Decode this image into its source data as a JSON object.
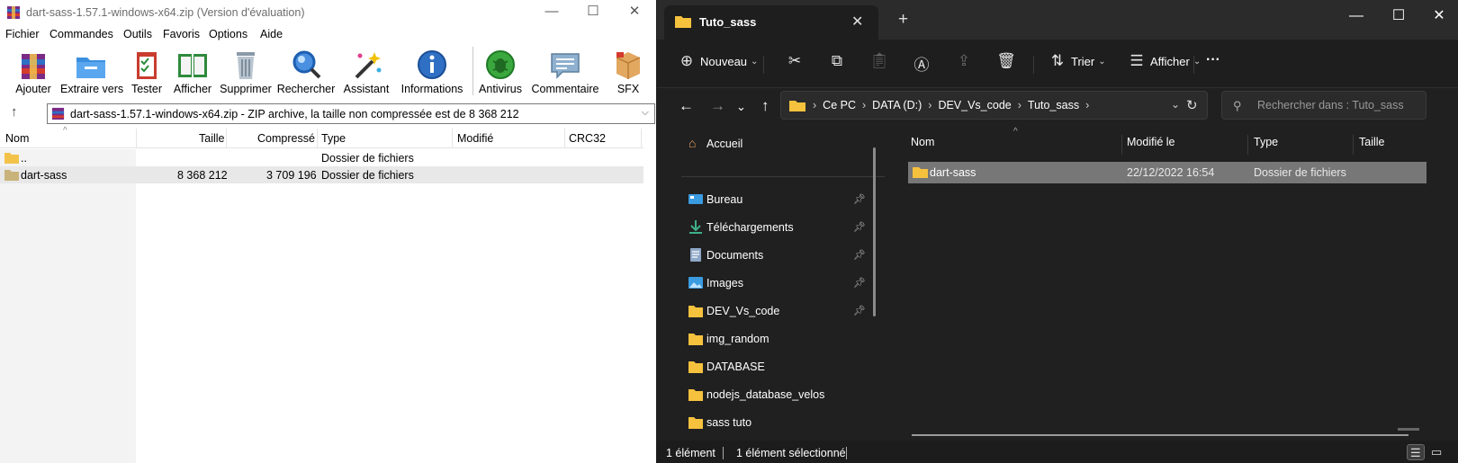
{
  "winrar": {
    "title": "dart-sass-1.57.1-windows-x64.zip (Version d'évaluation)",
    "window_buttons": {
      "minimize": "—",
      "maximize": "☐",
      "close": "✕"
    },
    "menu": [
      "Fichier",
      "Commandes",
      "Outils",
      "Favoris",
      "Options",
      "Aide"
    ],
    "toolbar": [
      "Ajouter",
      "Extraire vers",
      "Tester",
      "Afficher",
      "Supprimer",
      "Rechercher",
      "Assistant",
      "Informations",
      "Antivirus",
      "Commentaire",
      "SFX"
    ],
    "address": "dart-sass-1.57.1-windows-x64.zip - ZIP archive, la taille non compressée est de 8 368 212",
    "columns": [
      "Nom",
      "Taille",
      "Compressé",
      "Type",
      "Modifié",
      "CRC32"
    ],
    "rows": [
      {
        "name": "..",
        "size": "",
        "packed": "",
        "type": "Dossier de fichiers",
        "modified": "",
        "crc": ""
      },
      {
        "name": "dart-sass",
        "size": "8 368 212",
        "packed": "3 709 196",
        "type": "Dossier de fichiers",
        "modified": "",
        "crc": ""
      }
    ]
  },
  "explorer": {
    "tab_title": "Tuto_sass",
    "tab_close": "✕",
    "new_tab": "+",
    "window_buttons": {
      "minimize": "—",
      "maximize": "☐",
      "close": "✕"
    },
    "command_bar": {
      "new": "Nouveau",
      "sort": "Trier",
      "view": "Afficher",
      "more": "···"
    },
    "breadcrumb": [
      "Ce PC",
      "DATA (D:)",
      "DEV_Vs_code",
      "Tuto_sass"
    ],
    "search_placeholder": "Rechercher dans : Tuto_sass",
    "nav": {
      "home": "Accueil",
      "pinned": [
        "Bureau",
        "Téléchargements",
        "Documents",
        "Images",
        "DEV_Vs_code"
      ],
      "folders": [
        "img_random",
        "DATABASE",
        "nodejs_database_velos",
        "sass tuto"
      ]
    },
    "columns": [
      "Nom",
      "Modifié le",
      "Type",
      "Taille"
    ],
    "files": [
      {
        "name": "dart-sass",
        "modified": "22/12/2022 16:54",
        "type": "Dossier de fichiers",
        "size": ""
      }
    ],
    "status": {
      "count": "1 élément",
      "selected": "1 élément sélectionné"
    },
    "colors": {
      "folder": "#f6c23e",
      "selection": "#777777",
      "background": "#202020"
    }
  }
}
